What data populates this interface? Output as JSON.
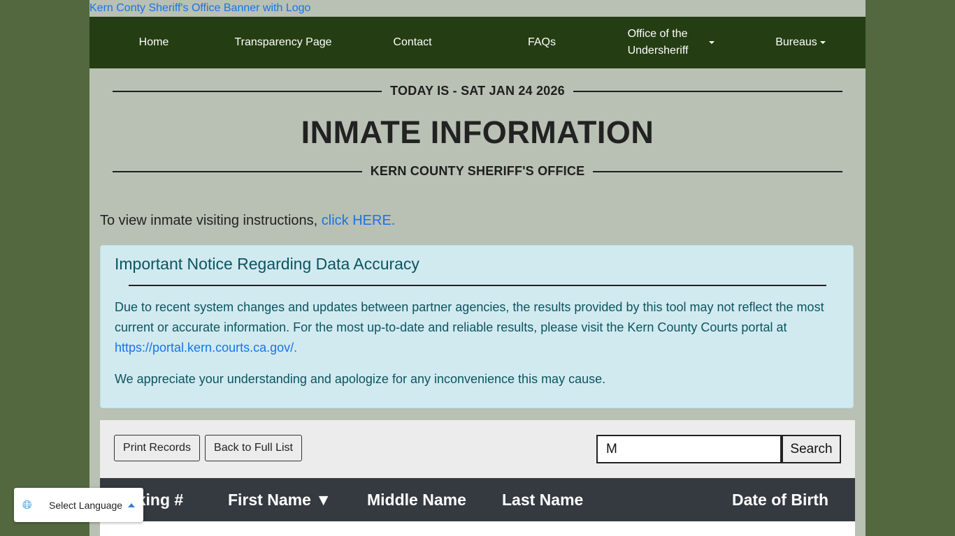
{
  "banner": {
    "alt_text": "Kern Conty Sheriff's Office Banner with Logo"
  },
  "nav": {
    "items": [
      {
        "label": "Home"
      },
      {
        "label": "Transparency Page"
      },
      {
        "label": "Contact"
      },
      {
        "label": "FAQs"
      },
      {
        "label_line1": "Office of the",
        "label_line2": "Undersheriff"
      },
      {
        "label": "Bureaus"
      }
    ]
  },
  "header": {
    "date_text": "TODAY IS - SAT JAN 24 2026",
    "title": "INMATE INFORMATION",
    "subtitle": "KERN COUNTY SHERIFF'S OFFICE"
  },
  "visiting": {
    "text": "To view inmate visiting instructions,",
    "link": "click HERE."
  },
  "notice": {
    "title": "Important Notice Regarding Data Accuracy",
    "para1": "Due to recent system changes and updates between partner agencies, the results provided by this tool may not reflect the most current or accurate information. For the most up-to-date and reliable results, please visit the Kern County Courts portal at",
    "link": "https://portal.kern.courts.ca.gov/.",
    "para2": "We appreciate your understanding and apologize for any inconvenience this may cause."
  },
  "toolbar": {
    "print_label": "Print Records",
    "back_label": "Back to Full List",
    "search_value": "M",
    "search_label": "Search"
  },
  "table": {
    "headers": [
      "Booking #",
      "First Name ▼",
      "Middle Name",
      "Last Name",
      "Date of Birth"
    ]
  },
  "language": {
    "label": "Select Language",
    "icon": "globe-icon"
  },
  "colors": {
    "background": "#53683f",
    "page": "#b8c1b4",
    "nav": "#243d12",
    "notice_bg": "#d1eaf0",
    "notice_text": "#0c5460",
    "link": "#1a73e8",
    "table_header": "#343a40"
  }
}
